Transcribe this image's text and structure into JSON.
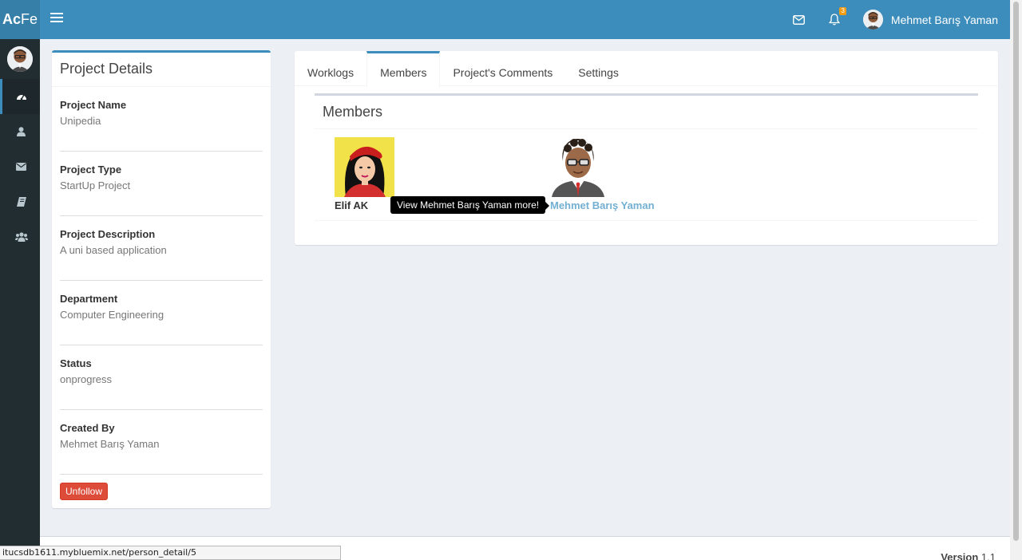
{
  "header": {
    "logo_bold": "Ac",
    "logo_light": "Fe",
    "notification_count": "3",
    "user_name": "Mehmet Barış Yaman"
  },
  "sidebar": {
    "items": [
      {
        "icon": "dashboard-icon",
        "active": true
      },
      {
        "icon": "user-icon",
        "active": false
      },
      {
        "icon": "envelope-icon",
        "active": false
      },
      {
        "icon": "book-icon",
        "active": false
      },
      {
        "icon": "users-icon",
        "active": false
      }
    ]
  },
  "project": {
    "title": "Project Details",
    "fields": [
      {
        "label": "Project Name",
        "value": "Unipedia"
      },
      {
        "label": "Project Type",
        "value": "StartUp Project"
      },
      {
        "label": "Project Description",
        "value": "A uni based application"
      },
      {
        "label": "Department",
        "value": "Computer Engineering"
      },
      {
        "label": "Status",
        "value": "onprogress"
      },
      {
        "label": "Created By",
        "value": "Mehmet Barış Yaman"
      }
    ],
    "unfollow_label": "Unfollow"
  },
  "tabs": [
    {
      "label": "Worklogs",
      "active": false
    },
    {
      "label": "Members",
      "active": true
    },
    {
      "label": "Project's Comments",
      "active": false
    },
    {
      "label": "Settings",
      "active": false
    }
  ],
  "members": {
    "title": "Members",
    "list": [
      {
        "name": "Elif AK"
      },
      {
        "name": "Mehmet Barış Yaman"
      }
    ],
    "tooltip": "View Mehmet Barış Yaman more!"
  },
  "footer": {
    "version_label": "Version",
    "version_number": "1.1"
  },
  "status_url": "itucsdb1611.mybluemix.net/person_detail/5",
  "colors": {
    "header": "#3c8dbc",
    "sidebar": "#222d32",
    "danger": "#dd4b39",
    "link": "#72afd2"
  }
}
